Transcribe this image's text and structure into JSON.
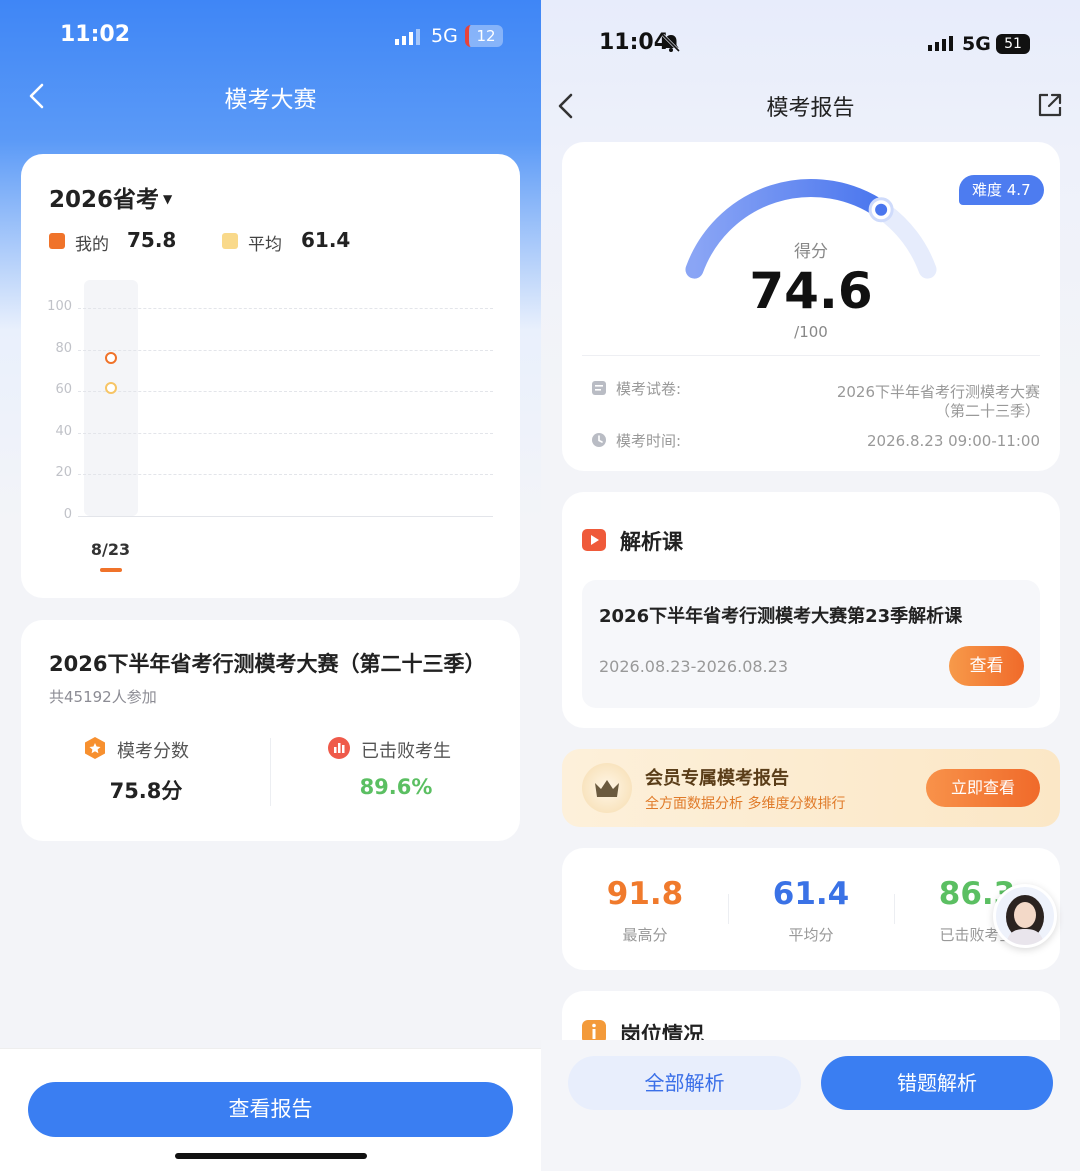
{
  "left": {
    "status": {
      "time": "11:02",
      "network": "5G",
      "battery": "12"
    },
    "nav": {
      "title": "模考大赛"
    },
    "chart_card": {
      "exam_selector": "2026省考",
      "legend_mine_label": "我的",
      "legend_mine_value": "75.8",
      "legend_avg_label": "平均",
      "legend_avg_value": "61.4"
    },
    "chart_data": {
      "type": "scatter",
      "categories": [
        "8/23"
      ],
      "series": [
        {
          "name": "我的",
          "values": [
            75.8
          ],
          "color": "#f0732a"
        },
        {
          "name": "平均",
          "values": [
            61.4
          ],
          "color": "#f7c566"
        }
      ],
      "yticks": [
        "100",
        "80",
        "60",
        "40",
        "20",
        "0"
      ],
      "ylim": [
        0,
        100
      ],
      "grid": true
    },
    "info_card": {
      "title": "2026下半年省考行测模考大赛（第二十三季）",
      "participants": "共45192人参加",
      "stat1_label": "模考分数",
      "stat1_value": "75.8分",
      "stat2_label": "已击败考生",
      "stat2_value": "89.6%"
    },
    "bottom_button": "查看报告"
  },
  "right": {
    "status": {
      "time": "11:04",
      "network": "5G",
      "battery": "51"
    },
    "nav": {
      "title": "模考报告"
    },
    "score_card": {
      "difficulty": "难度 4.7",
      "score_label": "得分",
      "score": "74.6",
      "total": "/100",
      "score_value": 74.6,
      "score_max": 100,
      "paper_label": "模考试卷:",
      "paper_value_line1": "2026下半年省考行测模考大赛",
      "paper_value_line2": "（第二十三季）",
      "time_label": "模考时间:",
      "time_value": "2026.8.23 09:00-11:00"
    },
    "course_card": {
      "heading": "解析课",
      "course_title": "2026下半年省考行测模考大赛第23季解析课",
      "course_date": "2026.08.23-2026.08.23",
      "view_button": "查看"
    },
    "vip_banner": {
      "title": "会员专属模考报告",
      "subtitle": "全方面数据分析 多维度分数排行",
      "button": "立即查看"
    },
    "stats": [
      {
        "value": "91.8",
        "label": "最高分",
        "color": "#f07a2c"
      },
      {
        "value": "61.4",
        "label": "平均分",
        "color": "#3a72e6"
      },
      {
        "value": "86.3",
        "label": "已击败考生",
        "color": "#5bbf62"
      }
    ],
    "position_heading": "岗位情况",
    "bottom_buttons": {
      "all": "全部解析",
      "wrong": "错题解析"
    }
  }
}
